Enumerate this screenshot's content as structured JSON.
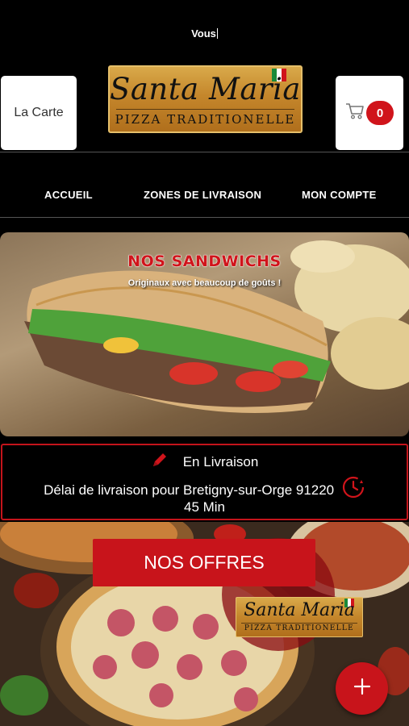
{
  "status": {
    "text": "Vous"
  },
  "header": {
    "menu_label": "La Carte",
    "cart_count": "0",
    "logo": {
      "name": "Santa Maria",
      "tagline": "PIZZA TRADITIONELLE"
    }
  },
  "nav": {
    "items": [
      "ACCUEIL",
      "ZONES DE LIVRAISON",
      "MON COMPTE"
    ]
  },
  "banner": {
    "title": "NOS SANDWICHS",
    "subtitle": "Originaux avec beaucoup de goûts !"
  },
  "delivery": {
    "mode": "En Livraison",
    "info": "Délai de livraison pour Bretigny-sur-Orge 91220",
    "time": "45 Min"
  },
  "offers": {
    "button_label": "NOS OFFRES",
    "logo": {
      "name": "Santa Maria",
      "tagline": "PIZZA TRADITIONELLE"
    }
  },
  "colors": {
    "accent": "#c8141b",
    "gold": "#c4862b",
    "background": "#000000"
  },
  "icons": [
    "cart-icon",
    "pencil-icon",
    "clock-icon",
    "plus-icon",
    "italian-flag-icon"
  ]
}
